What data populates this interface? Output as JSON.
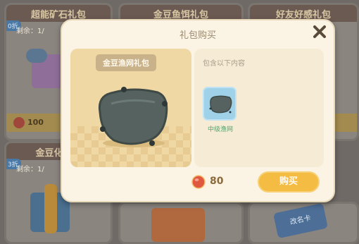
{
  "background": {
    "cards": [
      {
        "title": "超能矿石礼包",
        "stock": "剩余：1/",
        "discount": "0折"
      },
      {
        "title": "金豆鱼饵礼包"
      },
      {
        "title": "好友好感礼包"
      },
      {
        "title": "金豆化肥礼",
        "stock": "剩余：1/",
        "discount": "3折"
      },
      {
        "title": ""
      },
      {
        "title": ""
      }
    ],
    "price_left": "100",
    "rename_card_label": "改名卡"
  },
  "dialog": {
    "title": "礼包购买",
    "pack_name": "金豆渔网礼包",
    "contents_label": "包含以下内容",
    "items": [
      {
        "name": "中级渔网",
        "icon": "net-pillow-icon"
      }
    ],
    "price": "80",
    "buy_label": "购买"
  },
  "colors": {
    "buy_button": "#f5bc44",
    "item_slot": "#9fd2e8",
    "item_name": "#56a26f"
  }
}
